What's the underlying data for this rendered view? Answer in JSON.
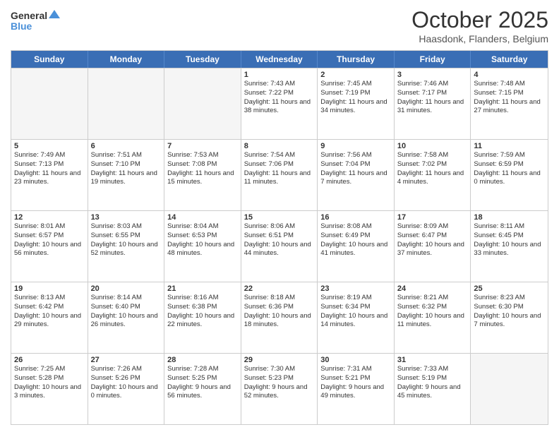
{
  "logo": {
    "line1": "General",
    "line2": "Blue"
  },
  "title": "October 2025",
  "location": "Haasdonk, Flanders, Belgium",
  "days_of_week": [
    "Sunday",
    "Monday",
    "Tuesday",
    "Wednesday",
    "Thursday",
    "Friday",
    "Saturday"
  ],
  "weeks": [
    [
      {
        "day": "",
        "sunrise": "",
        "sunset": "",
        "daylight": "",
        "empty": true
      },
      {
        "day": "",
        "sunrise": "",
        "sunset": "",
        "daylight": "",
        "empty": true
      },
      {
        "day": "",
        "sunrise": "",
        "sunset": "",
        "daylight": "",
        "empty": true
      },
      {
        "day": "1",
        "sunrise": "Sunrise: 7:43 AM",
        "sunset": "Sunset: 7:22 PM",
        "daylight": "Daylight: 11 hours and 38 minutes.",
        "empty": false
      },
      {
        "day": "2",
        "sunrise": "Sunrise: 7:45 AM",
        "sunset": "Sunset: 7:19 PM",
        "daylight": "Daylight: 11 hours and 34 minutes.",
        "empty": false
      },
      {
        "day": "3",
        "sunrise": "Sunrise: 7:46 AM",
        "sunset": "Sunset: 7:17 PM",
        "daylight": "Daylight: 11 hours and 31 minutes.",
        "empty": false
      },
      {
        "day": "4",
        "sunrise": "Sunrise: 7:48 AM",
        "sunset": "Sunset: 7:15 PM",
        "daylight": "Daylight: 11 hours and 27 minutes.",
        "empty": false
      }
    ],
    [
      {
        "day": "5",
        "sunrise": "Sunrise: 7:49 AM",
        "sunset": "Sunset: 7:13 PM",
        "daylight": "Daylight: 11 hours and 23 minutes.",
        "empty": false
      },
      {
        "day": "6",
        "sunrise": "Sunrise: 7:51 AM",
        "sunset": "Sunset: 7:10 PM",
        "daylight": "Daylight: 11 hours and 19 minutes.",
        "empty": false
      },
      {
        "day": "7",
        "sunrise": "Sunrise: 7:53 AM",
        "sunset": "Sunset: 7:08 PM",
        "daylight": "Daylight: 11 hours and 15 minutes.",
        "empty": false
      },
      {
        "day": "8",
        "sunrise": "Sunrise: 7:54 AM",
        "sunset": "Sunset: 7:06 PM",
        "daylight": "Daylight: 11 hours and 11 minutes.",
        "empty": false
      },
      {
        "day": "9",
        "sunrise": "Sunrise: 7:56 AM",
        "sunset": "Sunset: 7:04 PM",
        "daylight": "Daylight: 11 hours and 7 minutes.",
        "empty": false
      },
      {
        "day": "10",
        "sunrise": "Sunrise: 7:58 AM",
        "sunset": "Sunset: 7:02 PM",
        "daylight": "Daylight: 11 hours and 4 minutes.",
        "empty": false
      },
      {
        "day": "11",
        "sunrise": "Sunrise: 7:59 AM",
        "sunset": "Sunset: 6:59 PM",
        "daylight": "Daylight: 11 hours and 0 minutes.",
        "empty": false
      }
    ],
    [
      {
        "day": "12",
        "sunrise": "Sunrise: 8:01 AM",
        "sunset": "Sunset: 6:57 PM",
        "daylight": "Daylight: 10 hours and 56 minutes.",
        "empty": false
      },
      {
        "day": "13",
        "sunrise": "Sunrise: 8:03 AM",
        "sunset": "Sunset: 6:55 PM",
        "daylight": "Daylight: 10 hours and 52 minutes.",
        "empty": false
      },
      {
        "day": "14",
        "sunrise": "Sunrise: 8:04 AM",
        "sunset": "Sunset: 6:53 PM",
        "daylight": "Daylight: 10 hours and 48 minutes.",
        "empty": false
      },
      {
        "day": "15",
        "sunrise": "Sunrise: 8:06 AM",
        "sunset": "Sunset: 6:51 PM",
        "daylight": "Daylight: 10 hours and 44 minutes.",
        "empty": false
      },
      {
        "day": "16",
        "sunrise": "Sunrise: 8:08 AM",
        "sunset": "Sunset: 6:49 PM",
        "daylight": "Daylight: 10 hours and 41 minutes.",
        "empty": false
      },
      {
        "day": "17",
        "sunrise": "Sunrise: 8:09 AM",
        "sunset": "Sunset: 6:47 PM",
        "daylight": "Daylight: 10 hours and 37 minutes.",
        "empty": false
      },
      {
        "day": "18",
        "sunrise": "Sunrise: 8:11 AM",
        "sunset": "Sunset: 6:45 PM",
        "daylight": "Daylight: 10 hours and 33 minutes.",
        "empty": false
      }
    ],
    [
      {
        "day": "19",
        "sunrise": "Sunrise: 8:13 AM",
        "sunset": "Sunset: 6:42 PM",
        "daylight": "Daylight: 10 hours and 29 minutes.",
        "empty": false
      },
      {
        "day": "20",
        "sunrise": "Sunrise: 8:14 AM",
        "sunset": "Sunset: 6:40 PM",
        "daylight": "Daylight: 10 hours and 26 minutes.",
        "empty": false
      },
      {
        "day": "21",
        "sunrise": "Sunrise: 8:16 AM",
        "sunset": "Sunset: 6:38 PM",
        "daylight": "Daylight: 10 hours and 22 minutes.",
        "empty": false
      },
      {
        "day": "22",
        "sunrise": "Sunrise: 8:18 AM",
        "sunset": "Sunset: 6:36 PM",
        "daylight": "Daylight: 10 hours and 18 minutes.",
        "empty": false
      },
      {
        "day": "23",
        "sunrise": "Sunrise: 8:19 AM",
        "sunset": "Sunset: 6:34 PM",
        "daylight": "Daylight: 10 hours and 14 minutes.",
        "empty": false
      },
      {
        "day": "24",
        "sunrise": "Sunrise: 8:21 AM",
        "sunset": "Sunset: 6:32 PM",
        "daylight": "Daylight: 10 hours and 11 minutes.",
        "empty": false
      },
      {
        "day": "25",
        "sunrise": "Sunrise: 8:23 AM",
        "sunset": "Sunset: 6:30 PM",
        "daylight": "Daylight: 10 hours and 7 minutes.",
        "empty": false
      }
    ],
    [
      {
        "day": "26",
        "sunrise": "Sunrise: 7:25 AM",
        "sunset": "Sunset: 5:28 PM",
        "daylight": "Daylight: 10 hours and 3 minutes.",
        "empty": false
      },
      {
        "day": "27",
        "sunrise": "Sunrise: 7:26 AM",
        "sunset": "Sunset: 5:26 PM",
        "daylight": "Daylight: 10 hours and 0 minutes.",
        "empty": false
      },
      {
        "day": "28",
        "sunrise": "Sunrise: 7:28 AM",
        "sunset": "Sunset: 5:25 PM",
        "daylight": "Daylight: 9 hours and 56 minutes.",
        "empty": false
      },
      {
        "day": "29",
        "sunrise": "Sunrise: 7:30 AM",
        "sunset": "Sunset: 5:23 PM",
        "daylight": "Daylight: 9 hours and 52 minutes.",
        "empty": false
      },
      {
        "day": "30",
        "sunrise": "Sunrise: 7:31 AM",
        "sunset": "Sunset: 5:21 PM",
        "daylight": "Daylight: 9 hours and 49 minutes.",
        "empty": false
      },
      {
        "day": "31",
        "sunrise": "Sunrise: 7:33 AM",
        "sunset": "Sunset: 5:19 PM",
        "daylight": "Daylight: 9 hours and 45 minutes.",
        "empty": false
      },
      {
        "day": "",
        "sunrise": "",
        "sunset": "",
        "daylight": "",
        "empty": true
      }
    ]
  ]
}
